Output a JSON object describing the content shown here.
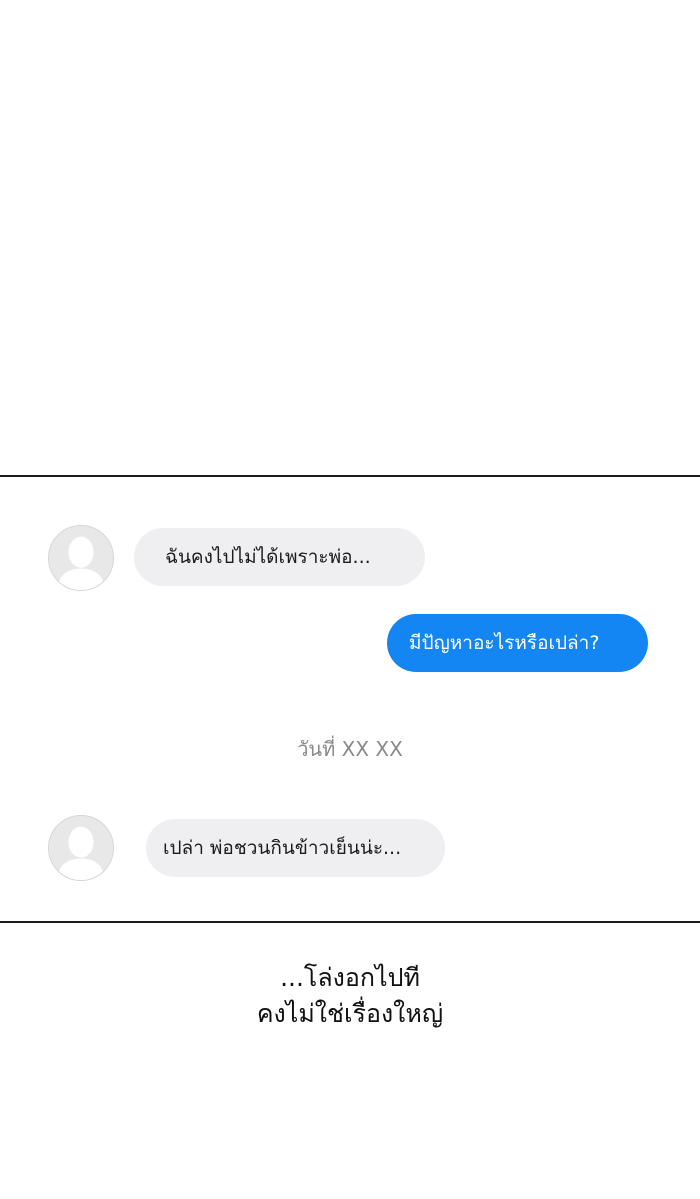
{
  "chat": {
    "messages": [
      {
        "side": "received",
        "text": "ฉันคงไปไม่ได้เพราะพ่อ..."
      },
      {
        "side": "sent",
        "text": "มีปัญหาอะไรหรือเปล่า?"
      },
      {
        "side": "received",
        "text": "เปล่า พ่อชวนกินข้าวเย็นน่ะ..."
      }
    ],
    "date_separator": "วันที่ XX XX",
    "colors": {
      "sent_bubble": "#1486f3",
      "received_bubble": "#efeff1"
    }
  },
  "caption": {
    "line1": "...โล่งอกไปที",
    "line2": "คงไม่ใช่เรื่องใหญ่"
  }
}
